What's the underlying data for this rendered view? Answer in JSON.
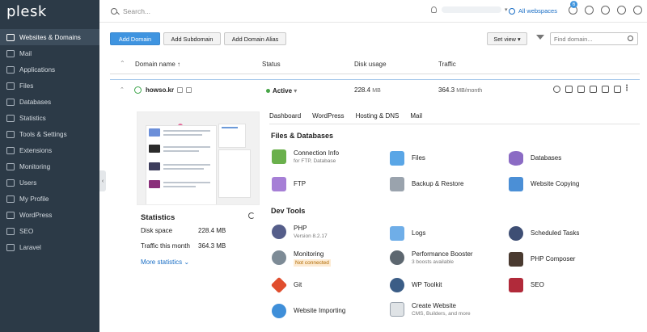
{
  "brand": {
    "logo": "plesk"
  },
  "sidebar": {
    "items": [
      {
        "label": "Websites & Domains",
        "icon": "websites-icon",
        "active": true
      },
      {
        "label": "Mail",
        "icon": "mail-icon"
      },
      {
        "label": "Applications",
        "icon": "applications-icon"
      },
      {
        "label": "Files",
        "icon": "files-icon"
      },
      {
        "label": "Databases",
        "icon": "databases-icon"
      },
      {
        "label": "Statistics",
        "icon": "statistics-icon"
      },
      {
        "label": "Tools & Settings",
        "icon": "tools-icon"
      },
      {
        "label": "Extensions",
        "icon": "extensions-icon"
      },
      {
        "label": "Monitoring",
        "icon": "monitoring-icon"
      },
      {
        "label": "Users",
        "icon": "users-icon"
      },
      {
        "label": "My Profile",
        "icon": "profile-icon"
      },
      {
        "label": "WordPress",
        "icon": "wordpress-icon"
      },
      {
        "label": "SEO",
        "icon": "seo-icon"
      },
      {
        "label": "Laravel",
        "icon": "laravel-icon"
      }
    ]
  },
  "topbar": {
    "search_placeholder": "Search...",
    "workspaces": "All webspaces",
    "notifications_count": "6"
  },
  "toolbar": {
    "add_domain": "Add Domain",
    "add_subdomain": "Add Subdomain",
    "add_alias": "Add Domain Alias",
    "set_view": "Set view",
    "find_placeholder": "Find domain..."
  },
  "table": {
    "col_domain": "Domain name ↑",
    "col_status": "Status",
    "col_disk": "Disk usage",
    "col_traffic": "Traffic"
  },
  "domain": {
    "name": "howso.kr",
    "status": "Active",
    "disk_value": "228.4",
    "disk_unit": "MB",
    "traffic_value": "364.3",
    "traffic_unit": "MB/month"
  },
  "stats": {
    "title": "Statistics",
    "disk_label": "Disk space",
    "disk_value": "228.4 MB",
    "traffic_label": "Traffic this month",
    "traffic_value": "364.3 MB",
    "more": "More statistics"
  },
  "tabs": [
    "Dashboard",
    "WordPress",
    "Hosting & DNS",
    "Mail"
  ],
  "sections": {
    "files": "Files & Databases",
    "dev": "Dev Tools"
  },
  "tools": {
    "connection": {
      "name": "Connection Info",
      "sub": "for FTP, Database"
    },
    "files": {
      "name": "Files"
    },
    "databases": {
      "name": "Databases"
    },
    "ftp": {
      "name": "FTP"
    },
    "backup": {
      "name": "Backup & Restore"
    },
    "copying": {
      "name": "Website Copying"
    },
    "php": {
      "name": "PHP",
      "sub": "Version 8.2.17"
    },
    "logs": {
      "name": "Logs"
    },
    "scheduled": {
      "name": "Scheduled Tasks"
    },
    "monitoring": {
      "name": "Monitoring",
      "sub": "Not connected"
    },
    "booster": {
      "name": "Performance Booster",
      "sub": "3 boosts available"
    },
    "composer": {
      "name": "PHP Composer"
    },
    "git": {
      "name": "Git"
    },
    "wptoolkit": {
      "name": "WP Toolkit"
    },
    "seo": {
      "name": "SEO"
    },
    "importing": {
      "name": "Website Importing"
    },
    "create": {
      "name": "Create Website",
      "sub": "CMS, Builders, and more"
    }
  },
  "colors": {
    "sidebar_bg": "#2c3a47",
    "accent": "#3f94e0",
    "link": "#1a6ec5",
    "active_green": "#47a547"
  }
}
